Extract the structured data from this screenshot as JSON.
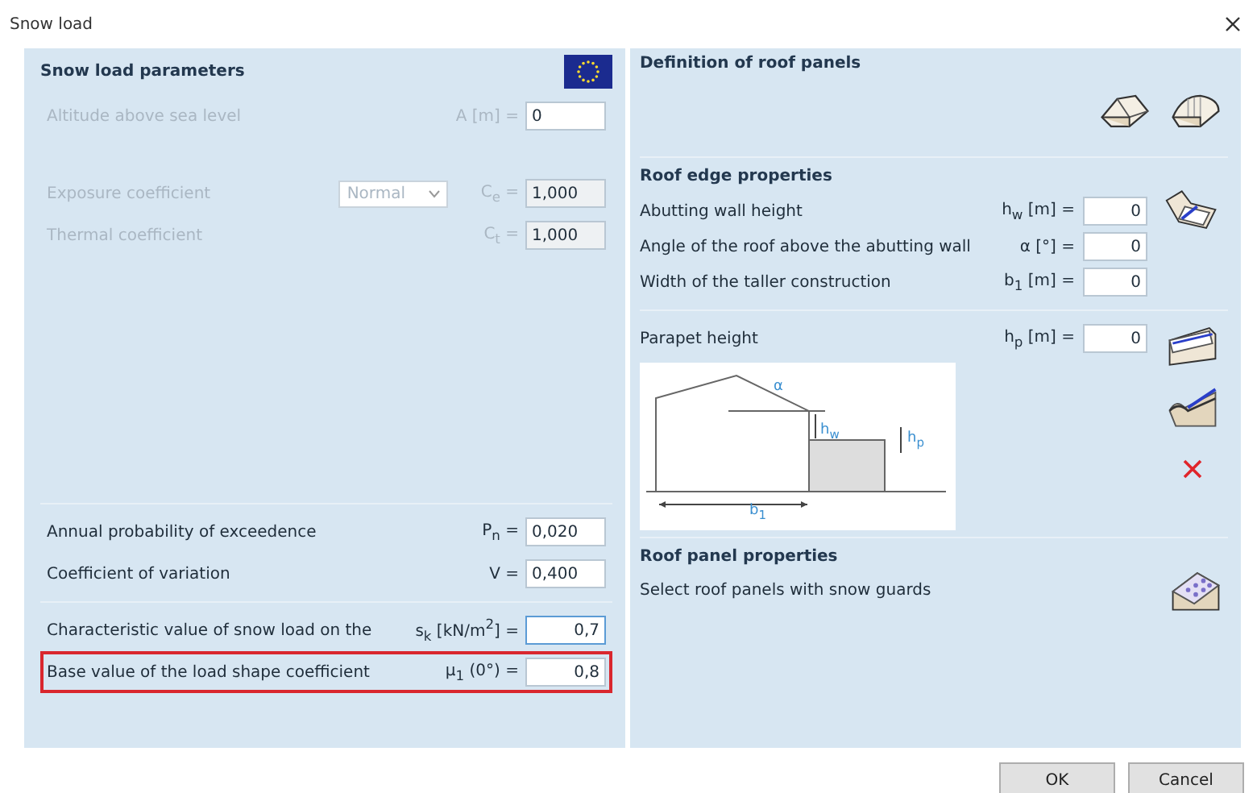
{
  "window": {
    "title": "Snow load"
  },
  "parameters": {
    "title": "Snow load parameters",
    "sections": [
      {
        "groups": [
          [
            {
              "label": "Altitude above sea level",
              "symbol": "A [m] =",
              "value": "0",
              "disabled": true,
              "readonly": false,
              "highlighted": false,
              "focused": false
            }
          ],
          [
            {
              "label": "Exposure coefficient",
              "dropdown": {
                "value": "Normal",
                "disabled": true
              },
              "symbol": "C$_{e}$ =",
              "value": "1,000",
              "disabled": true,
              "readonly": true,
              "highlighted": false,
              "focused": false
            },
            {
              "label": "Thermal coefficient",
              "symbol": "C$_{t}$ =",
              "value": "1,000",
              "disabled": true,
              "readonly": true,
              "highlighted": false,
              "focused": false
            }
          ]
        ]
      },
      {
        "groups": [
          [
            {
              "label": "Annual probability of exceedence",
              "symbol": "P$_{n}$ =",
              "value": "0,020",
              "disabled": false,
              "readonly": false,
              "highlighted": false,
              "focused": false
            },
            {
              "label": "Coefficient of variation",
              "symbol": "V =",
              "value": "0,400",
              "disabled": false,
              "readonly": false,
              "highlighted": false,
              "focused": false
            }
          ],
          [
            {
              "label": "Characteristic value of snow load on the",
              "symbol": "s$_{k}$ [kN/m$^{2}$] =",
              "value": "0,7",
              "disabled": false,
              "readonly": false,
              "highlighted": false,
              "focused": true
            },
            {
              "label": "Base value of the load shape coefficient",
              "symbol": "μ$_{1}$ (0°) =",
              "value": "0,8",
              "disabled": false,
              "readonly": false,
              "highlighted": true,
              "focused": false
            }
          ]
        ]
      }
    ]
  },
  "roof_panels": {
    "title": "Definition of roof panels"
  },
  "roof_edge": {
    "title": "Roof edge properties",
    "rows": [
      {
        "label": "Abutting wall height",
        "symbol": "h$_{w}$ [m] =",
        "value": "0"
      },
      {
        "label": "Angle of the roof above the abutting wall",
        "symbol": "α [°] =",
        "value": "0"
      },
      {
        "label": "Width of the taller construction",
        "symbol": "b$_{1}$ [m] =",
        "value": "0"
      }
    ]
  },
  "parapet": {
    "label": "Parapet height",
    "symbol": "h$_{p}$ [m] =",
    "value": "0",
    "diagram_labels": [
      "α",
      "h$_{w}$",
      "h$_{p}$",
      "b$_{1}$"
    ]
  },
  "roof_panel_properties": {
    "title": "Roof panel properties",
    "text": "Select roof panels with snow guards"
  },
  "buttons": [
    "OK",
    "Cancel"
  ]
}
